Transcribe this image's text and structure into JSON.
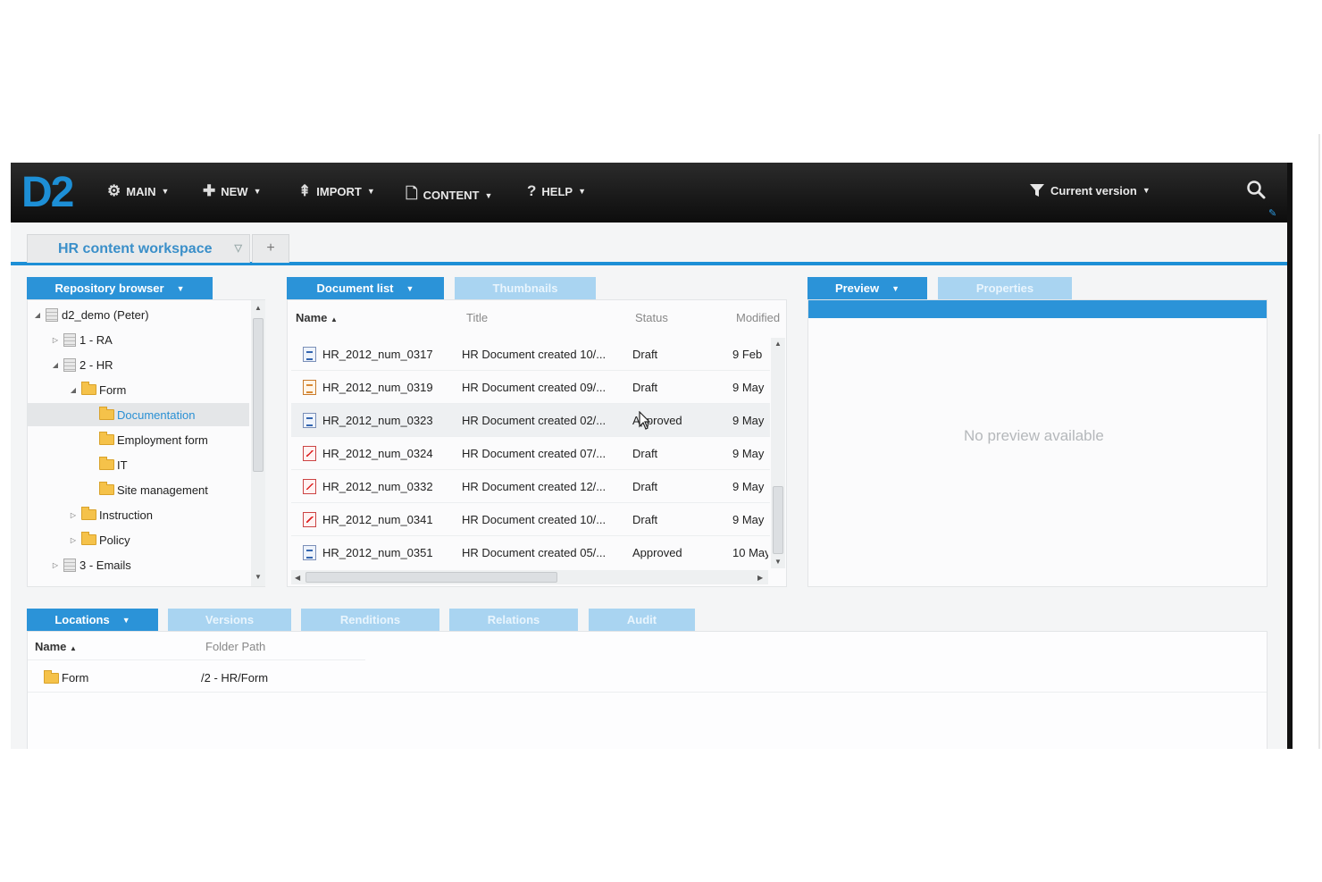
{
  "app": {
    "logo": "D2",
    "menus": [
      {
        "label": "MAIN",
        "icon": "gear-icon"
      },
      {
        "label": "NEW",
        "icon": "plus-icon"
      },
      {
        "label": "IMPORT",
        "icon": "import-icon"
      },
      {
        "label": "CONTENT",
        "icon": "document-icon"
      },
      {
        "label": "HELP",
        "icon": "question-icon"
      }
    ],
    "filter_label": "Current version"
  },
  "workspace": {
    "tab_label": "HR content workspace",
    "add_tab": "+"
  },
  "repository": {
    "tab_label": "Repository browser",
    "tree": [
      {
        "label": "d2_demo (Peter)",
        "level": 0,
        "type": "repo",
        "expanded": true
      },
      {
        "label": "1 - RA",
        "level": 1,
        "type": "cabinet",
        "expanded": false
      },
      {
        "label": "2 - HR",
        "level": 1,
        "type": "cabinet",
        "expanded": true
      },
      {
        "label": "Form",
        "level": 2,
        "type": "folder",
        "expanded": true
      },
      {
        "label": "Documentation",
        "level": 3,
        "type": "folder",
        "selected": true
      },
      {
        "label": "Employment form",
        "level": 3,
        "type": "folder"
      },
      {
        "label": "IT",
        "level": 3,
        "type": "folder"
      },
      {
        "label": "Site management",
        "level": 3,
        "type": "folder"
      },
      {
        "label": "Instruction",
        "level": 2,
        "type": "folder",
        "expanded": false
      },
      {
        "label": "Policy",
        "level": 2,
        "type": "folder",
        "expanded": false
      },
      {
        "label": "3 - Emails",
        "level": 1,
        "type": "cabinet",
        "expanded": false
      }
    ]
  },
  "documents": {
    "tabs": [
      "Document list",
      "Thumbnails"
    ],
    "columns": [
      "Name",
      "Title",
      "Status",
      "Modified"
    ],
    "rows": [
      {
        "icon": "word",
        "name": "HR_2012_num_0317",
        "title": "HR Document created 10/...",
        "status": "Draft",
        "modified": "9 Feb"
      },
      {
        "icon": "xml",
        "name": "HR_2012_num_0319",
        "title": "HR Document created 09/...",
        "status": "Draft",
        "modified": "9 May"
      },
      {
        "icon": "word",
        "name": "HR_2012_num_0323",
        "title": "HR Document created 02/...",
        "status": "Approved",
        "modified": "9 May"
      },
      {
        "icon": "pdf",
        "name": "HR_2012_num_0324",
        "title": "HR Document created 07/...",
        "status": "Draft",
        "modified": "9 May"
      },
      {
        "icon": "pdf",
        "name": "HR_2012_num_0332",
        "title": "HR Document created 12/...",
        "status": "Draft",
        "modified": "9 May"
      },
      {
        "icon": "pdf",
        "name": "HR_2012_num_0341",
        "title": "HR Document created 10/...",
        "status": "Draft",
        "modified": "9 May"
      },
      {
        "icon": "word",
        "name": "HR_2012_num_0351",
        "title": "HR Document created 05/...",
        "status": "Approved",
        "modified": "10 May"
      }
    ]
  },
  "preview": {
    "tabs": [
      "Preview",
      "Properties"
    ],
    "empty_text": "No preview available"
  },
  "bottom": {
    "tabs": [
      "Locations",
      "Versions",
      "Renditions",
      "Relations",
      "Audit"
    ],
    "columns": [
      "Name",
      "Folder Path"
    ],
    "rows": [
      {
        "name": "Form",
        "path": "/2 - HR/Form"
      }
    ]
  },
  "colors": {
    "accent": "#2b93d8",
    "accent_light": "#a9d4f1",
    "topbar": "#111111",
    "logo": "#1d8fd6"
  }
}
